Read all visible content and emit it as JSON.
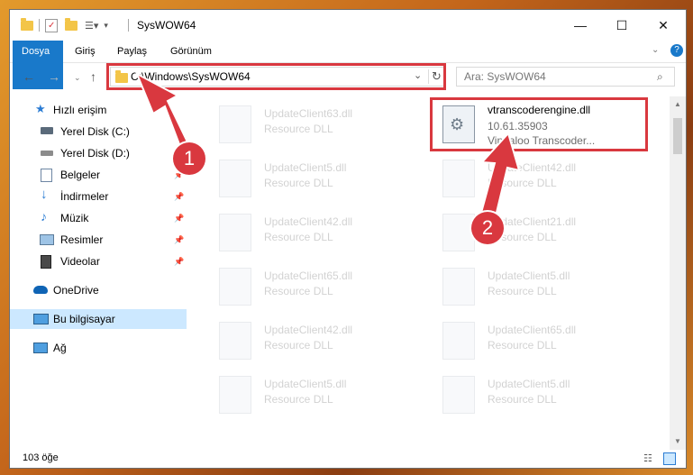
{
  "window": {
    "title": "SysWOW64",
    "minimize": "—",
    "maximize": "☐",
    "close": "✕"
  },
  "ribbon": {
    "tabs": [
      "Dosya",
      "Giriş",
      "Paylaş",
      "Görünüm"
    ],
    "help": "?"
  },
  "nav": {
    "address": "C:\\Windows\\SysWOW64",
    "search_placeholder": "Ara: SysWOW64"
  },
  "sidebar": [
    {
      "label": "Hızlı erişim",
      "icon": "star-icon"
    },
    {
      "label": "Yerel Disk (C:)",
      "icon": "drive-icon"
    },
    {
      "label": "Yerel Disk (D:)",
      "icon": "drive-icon"
    },
    {
      "label": "Belgeler",
      "icon": "documents-icon"
    },
    {
      "label": "İndirmeler",
      "icon": "download-icon"
    },
    {
      "label": "Müzik",
      "icon": "music-icon"
    },
    {
      "label": "Resimler",
      "icon": "pictures-icon"
    },
    {
      "label": "Videolar",
      "icon": "videos-icon"
    },
    {
      "label": "OneDrive",
      "icon": "cloud-icon"
    },
    {
      "label": "Bu bilgisayar",
      "icon": "computer-icon"
    },
    {
      "label": "Ağ",
      "icon": "network-icon"
    }
  ],
  "files": {
    "highlighted": {
      "name": "vtranscoderengine.dll",
      "version": "10.61.35903",
      "desc": "Vindaloo Transcoder..."
    },
    "left": [
      {
        "name": "UpdateClient63.dll",
        "desc": "Resource DLL"
      },
      {
        "name": "UpdateClient5.dll",
        "desc": "Resource DLL"
      },
      {
        "name": "UpdateClient42.dll",
        "desc": "Resource DLL"
      },
      {
        "name": "UpdateClient65.dll",
        "desc": "Resource DLL"
      },
      {
        "name": "UpdateClient42.dll",
        "desc": "Resource DLL"
      },
      {
        "name": "UpdateClient5.dll",
        "desc": "Resource DLL"
      }
    ],
    "right": [
      {
        "name": "UpdateClient42.dll",
        "desc": "Resource DLL"
      },
      {
        "name": "UpdateClient21.dll",
        "desc": "Resource DLL"
      },
      {
        "name": "UpdateClient5.dll",
        "desc": "Resource DLL"
      },
      {
        "name": "UpdateClient65.dll",
        "desc": "Resource DLL"
      },
      {
        "name": "UpdateClient5.dll",
        "desc": "Resource DLL"
      }
    ]
  },
  "status": {
    "count": "103 öğe"
  },
  "annotations": {
    "step1": "1",
    "step2": "2",
    "color": "#d9383f"
  }
}
